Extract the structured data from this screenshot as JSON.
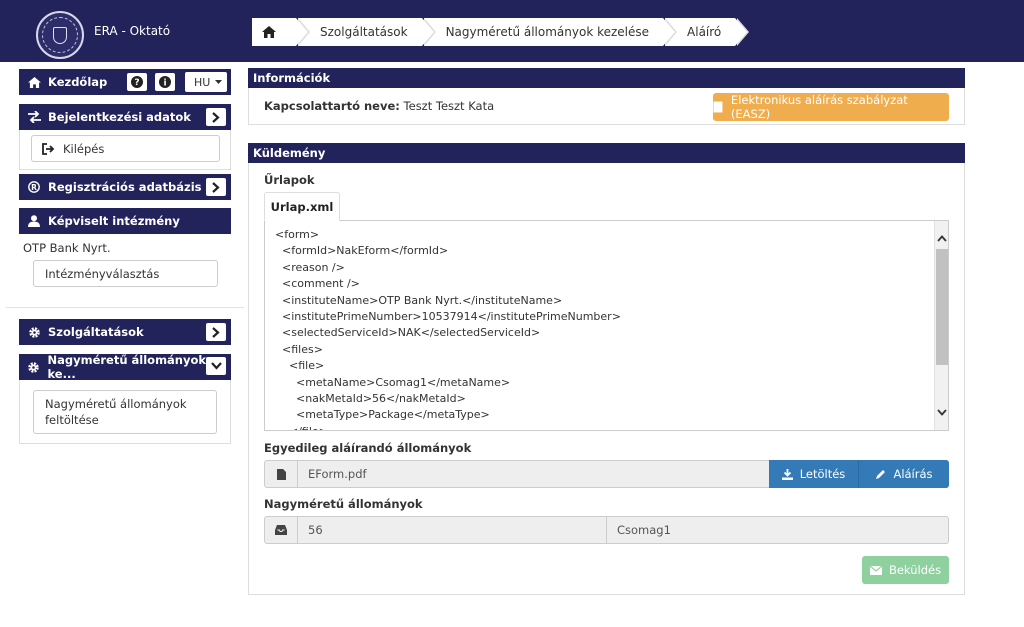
{
  "header": {
    "app_title": "ERA - Oktató",
    "breadcrumb": [
      "Szolgáltatások",
      "Nagyméretű állományok kezelése",
      "Aláíró"
    ]
  },
  "sidebar": {
    "home_label": "Kezdőlap",
    "lang": "HU",
    "login_section": "Bejelentkezési adatok",
    "logout_label": "Kilépés",
    "registry_section": "Regisztrációs adatbázis",
    "institution_section": "Képviselt intézmény",
    "institution_name": "OTP Bank Nyrt.",
    "institution_select": "Intézményválasztás",
    "services_section": "Szolgáltatások",
    "large_files_section": "Nagyméretű állományok ke...",
    "large_files_upload_line1": "Nagyméretű állományok",
    "large_files_upload_line2": "feltöltése"
  },
  "info_panel": {
    "title": "Információk",
    "contact_label": "Kapcsolattartó neve:",
    "contact_value": "Teszt Teszt Kata",
    "easz_button": "Elektronikus aláírás szabályzat (EASZ)"
  },
  "shipment_panel": {
    "title": "Küldemény",
    "forms_label": "Űrlapok",
    "tab_label": "Urlap.xml",
    "xml_lines": [
      "<form>",
      "  <formId>NakEform</formId>",
      "  <reason />",
      "  <comment />",
      "  <instituteName>OTP Bank Nyrt.</instituteName>",
      "  <institutePrimeNumber>10537914</institutePrimeNumber>",
      "  <selectedServiceId>NAK</selectedServiceId>",
      "  <files>",
      "    <file>",
      "      <metaName>Csomag1</metaName>",
      "      <nakMetaId>56</nakMetaId>",
      "      <metaType>Package</metaType>",
      "    </file>"
    ],
    "single_sign_label": "Egyedileg aláírandó állományok",
    "single_file_name": "EForm.pdf",
    "download_button": "Letöltés",
    "sign_button": "Aláírás",
    "large_files_label": "Nagyméretű állományok",
    "large_file_id": "56",
    "large_file_name": "Csomag1",
    "send_button": "Beküldés"
  },
  "colors": {
    "navy": "#23235b",
    "orange": "#f0ad4e",
    "blue": "#337ab7",
    "green": "#8fd19e"
  }
}
